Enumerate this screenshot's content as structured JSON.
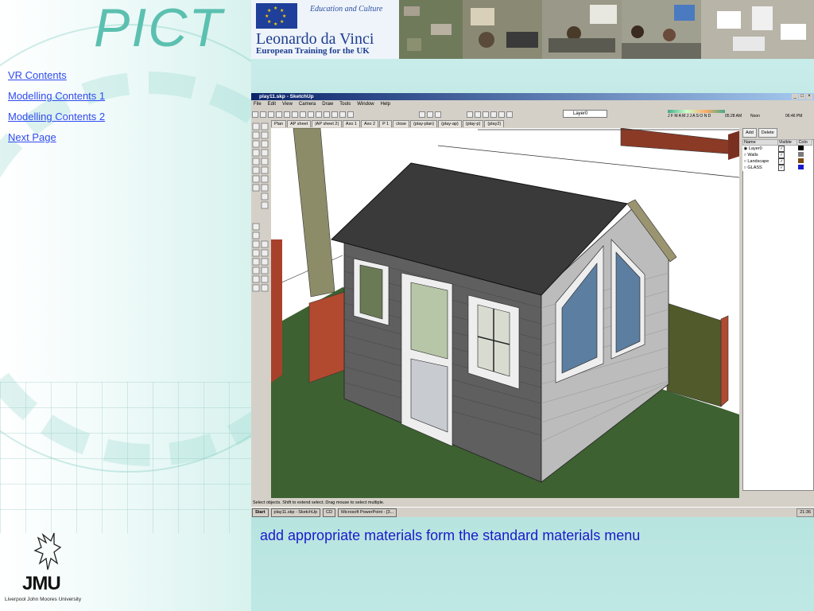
{
  "logo": {
    "text": "PICT"
  },
  "nav": {
    "items": [
      "VR Contents",
      "Modelling Contents 1",
      "Modelling Contents 2",
      "Next Page"
    ]
  },
  "jmu": {
    "letters": "JMU",
    "university": "Liverpool John Moores University"
  },
  "banner": {
    "program_line1": "Education and Culture",
    "program_name": "Leonardo da Vinci",
    "program_line3": "European Training for the UK"
  },
  "sketchup": {
    "title": "play11.skp - SketchUp",
    "menus": [
      "File",
      "Edit",
      "View",
      "Camera",
      "Draw",
      "Tools",
      "Window",
      "Help"
    ],
    "layer_selected": "Layer0",
    "shadow_months": "J F M A M J J A S O N D",
    "shadow_time1": "05:28 AM",
    "shadow_noon": "Noon",
    "shadow_time2": "06:46 PM",
    "scene_tabs": [
      "Plan",
      "AP sheet",
      "|AP sheet 2|",
      "Axo 1",
      "Axo 2",
      "P 1",
      "close",
      "(play-plan)",
      "(play-ap)",
      "(play-p)",
      "(play2)"
    ],
    "layers_panel": {
      "add": "Add",
      "delete": "Delete",
      "columns": [
        "Name",
        "Visible",
        "Colo"
      ],
      "rows": [
        {
          "name": "Layer0",
          "selected": true,
          "color": "#000000"
        },
        {
          "name": "Walls",
          "selected": false,
          "color": "#7a7a7a"
        },
        {
          "name": "Landscape",
          "selected": false,
          "color": "#7a4a10"
        },
        {
          "name": "GLASS",
          "selected": false,
          "color": "#1a1acc"
        }
      ]
    },
    "status_text": "Select objects. Shift to extend select. Drag mouse to select multiple.",
    "taskbar": {
      "start": "Start",
      "tasks": [
        "play11.skp - SketchUp",
        "CD",
        "Microsoft PowerPoint - [3..."
      ],
      "clock": "21:36"
    }
  },
  "caption": "add appropriate materials form the standard materials menu"
}
